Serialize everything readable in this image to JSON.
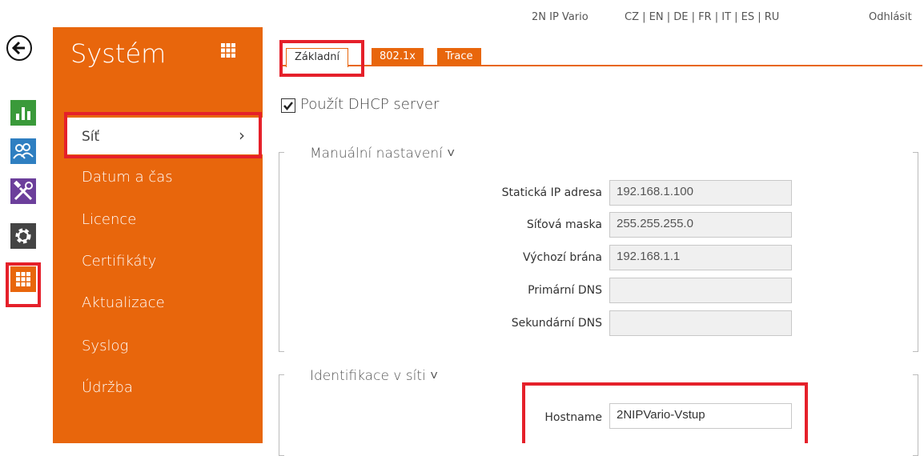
{
  "topbar": {
    "device": "2N IP Vario",
    "languages": "CZ | EN | DE | FR | IT | ES | RU",
    "logout": "Odhlásit"
  },
  "rail": {
    "icons": [
      "back-icon",
      "stats-icon",
      "users-icon",
      "tools-icon",
      "gear-icon",
      "grid-icon"
    ],
    "colors": {
      "stats": "#3a9a3a",
      "users": "#2f7fc1",
      "tools": "#6c3f9b",
      "settings": "#444444",
      "system": "#e8660c"
    }
  },
  "sidebar": {
    "title": "Systém",
    "active_item": "Síť",
    "items": [
      "Datum a čas",
      "Licence",
      "Certifikáty",
      "Aktualizace",
      "Syslog",
      "Údržba"
    ],
    "accent": "#e8660c"
  },
  "tabs": [
    "Základní",
    "802.1x",
    "Trace"
  ],
  "dhcp": {
    "label": "Použít DHCP server",
    "checked": true
  },
  "manual": {
    "title": "Manuální nastavení ˅",
    "fields": [
      {
        "label": "Statická IP adresa",
        "value": "192.168.1.100"
      },
      {
        "label": "Síťová maska",
        "value": "255.255.255.0"
      },
      {
        "label": "Výchozí brána",
        "value": "192.168.1.1"
      },
      {
        "label": "Primární DNS",
        "value": ""
      },
      {
        "label": "Sekundární DNS",
        "value": ""
      }
    ]
  },
  "identification": {
    "title": "Identifikace v síti ˅",
    "hostname_label": "Hostname",
    "hostname_value": "2NIPVario-Vstup"
  },
  "highlight_color": "#e5202a"
}
